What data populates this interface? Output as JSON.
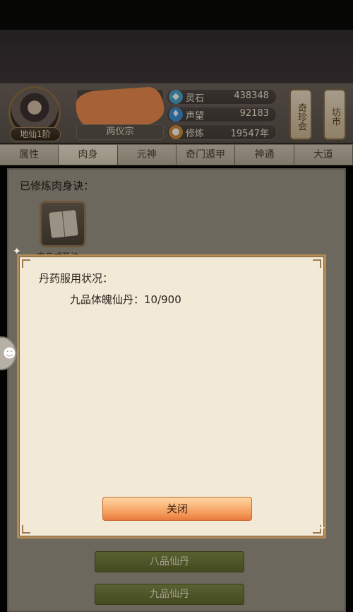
{
  "header": {
    "rank_badge": "地仙1阶",
    "sect": "两仪宗",
    "stats": [
      {
        "label": "灵石",
        "value": "438348",
        "icon": "spirit-stone-icon",
        "icon_glyph": "◆",
        "color": "#4aa3c8"
      },
      {
        "label": "声望",
        "value": "92183",
        "icon": "reputation-icon",
        "icon_glyph": "♦",
        "color": "#3c8fd6"
      },
      {
        "label": "修炼",
        "value": "19547年",
        "icon": "cultivation-icon",
        "icon_glyph": "●",
        "color": "#d08a3a"
      }
    ],
    "side_buttons": [
      "奇珍会",
      "坊市"
    ]
  },
  "tabs": [
    "属性",
    "肉身",
    "元神",
    "奇门遁甲",
    "神通",
    "大道"
  ],
  "active_tab": "肉身",
  "panel": {
    "title": "已修炼肉身诀：",
    "skill_label": "肉身成圣诀"
  },
  "bottom_buttons": [
    "八品仙丹",
    "九品仙丹"
  ],
  "modal": {
    "title": "丹药服用状况：",
    "line": "九品体魄仙丹：10/900",
    "close_label": "关闭"
  },
  "colors": {
    "accent_orange": "#f49a5a",
    "green_button": "#6f7a37",
    "modal_bg": "#f2ead7"
  }
}
